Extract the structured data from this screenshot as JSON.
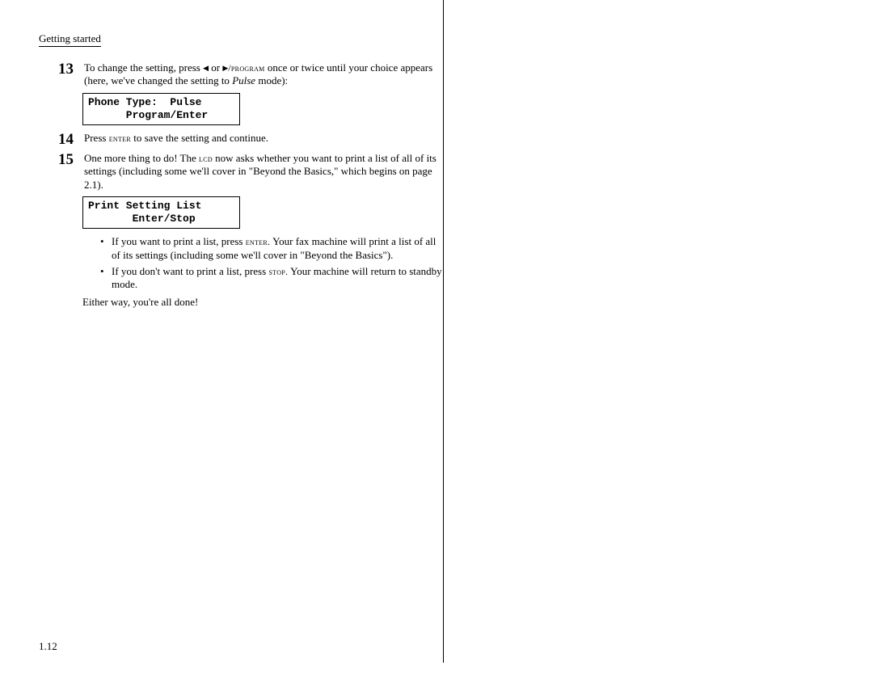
{
  "header": "Getting started",
  "pagenum": "1.12",
  "steps": {
    "s13": {
      "num": "13",
      "text_pre": "To change the setting, press ",
      "text_mid": " or ",
      "text_prog": "/program",
      "text_post": " once or twice until your choice appears (here, we've changed the setting to ",
      "pulse": "Pulse",
      "text_post2": " mode):"
    },
    "lcd1": {
      "line1": "Phone Type:  Pulse",
      "line2": "      Program/Enter"
    },
    "s14": {
      "num": "14",
      "text_pre": "Press ",
      "enter": "enter",
      "text_post": " to save the setting and continue."
    },
    "s15": {
      "num": "15",
      "text_pre": "One more thing to do! The ",
      "lcd": "lcd",
      "text_post": " now asks whether you want to print a list of all of its settings (including some we'll cover in \"Beyond the Basics,\" which begins on page 2.1)."
    },
    "lcd2": {
      "line1": "Print Setting List",
      "line2": "       Enter/Stop"
    },
    "bullets": {
      "b1_pre": "If you want to print a list, press ",
      "b1_enter": "enter.",
      "b1_post": " Your fax machine will print a list of all of its settings (including some we'll cover in \"Beyond the Basics\").",
      "b2_pre": "If you don't want to print a list, press ",
      "b2_stop": "stop.",
      "b2_post": " Your machine will return to standby mode."
    },
    "closing": "Either way, you're all done!"
  }
}
